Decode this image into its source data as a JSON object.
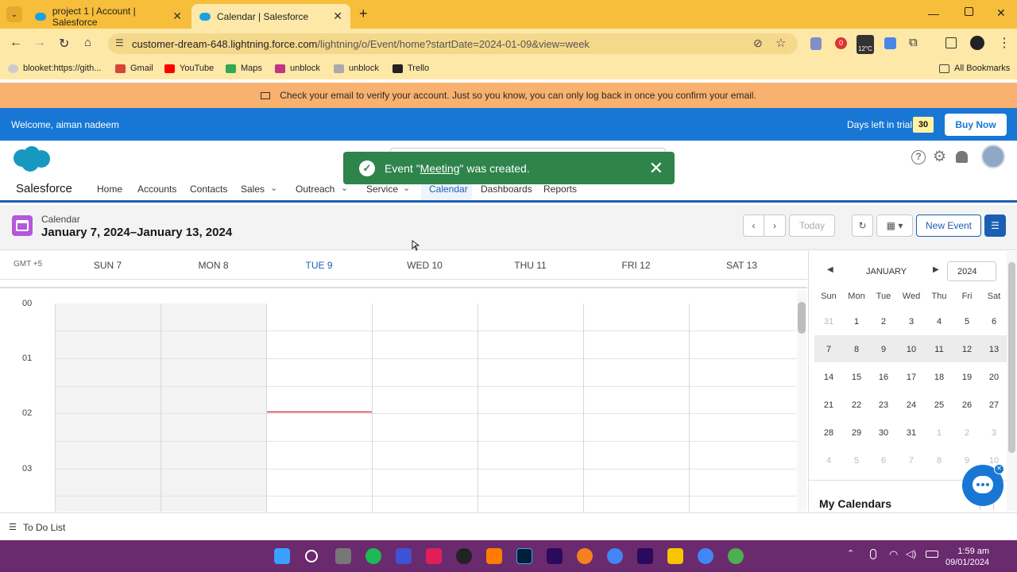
{
  "browser": {
    "tabs": [
      {
        "title": "project 1 | Account | Salesforce",
        "active": false
      },
      {
        "title": "Calendar | Salesforce",
        "active": true
      }
    ],
    "url_host": "customer-dream-648.lightning.force.com",
    "url_path": "/lightning/o/Event/home?startDate=2024-01-09&view=week",
    "bookmarks": [
      "blooket:https://gith...",
      "Gmail",
      "YouTube",
      "Maps",
      "unblock",
      "unblock",
      "Trello"
    ],
    "all_bookmarks": "All Bookmarks",
    "weather": "12°C"
  },
  "notice": "Check your email to verify your account. Just so you know, you can only log back in once you confirm your email.",
  "trial": {
    "welcome": "Welcome, aiman nadeem",
    "days_label": "Days left in trial:",
    "days": "30",
    "buy_now": "Buy Now"
  },
  "app": {
    "name": "Salesforce",
    "nav": [
      "Home",
      "Accounts",
      "Contacts",
      "Sales",
      "Outreach",
      "Service",
      "Calendar",
      "Dashboards",
      "Reports"
    ],
    "active_nav": "Calendar"
  },
  "toast": {
    "prefix": "Event \"",
    "link": "Meeting",
    "suffix": "\" was created."
  },
  "calendar": {
    "label": "Calendar",
    "range": "January 7, 2024–January 13, 2024",
    "today_button": "Today",
    "new_event": "New Event",
    "timezone": "GMT +5",
    "days": [
      "SUN 7",
      "MON 8",
      "TUE 9",
      "WED 10",
      "THU 11",
      "FRI 12",
      "SAT 13"
    ],
    "today_index": 2,
    "hours": [
      "00",
      "01",
      "02",
      "03"
    ]
  },
  "mini_calendar": {
    "month": "JANUARY",
    "year": "2024",
    "weekdays": [
      "Sun",
      "Mon",
      "Tue",
      "Wed",
      "Thu",
      "Fri",
      "Sat"
    ],
    "weeks": [
      [
        "31",
        "1",
        "2",
        "3",
        "4",
        "5",
        "6"
      ],
      [
        "7",
        "8",
        "9",
        "10",
        "11",
        "12",
        "13"
      ],
      [
        "14",
        "15",
        "16",
        "17",
        "18",
        "19",
        "20"
      ],
      [
        "21",
        "22",
        "23",
        "24",
        "25",
        "26",
        "27"
      ],
      [
        "28",
        "29",
        "30",
        "31",
        "1",
        "2",
        "3"
      ],
      [
        "4",
        "5",
        "6",
        "7",
        "8",
        "9",
        "10"
      ]
    ]
  },
  "my_calendars": "My Calendars",
  "todo": "To Do List",
  "clock": {
    "time": "1:59 am",
    "date": "09/01/2024"
  },
  "colors": {
    "accent": "#1b5fb3",
    "toast": "#2e844a",
    "trial_bar": "#1877d4",
    "notice": "#f8b16e"
  }
}
